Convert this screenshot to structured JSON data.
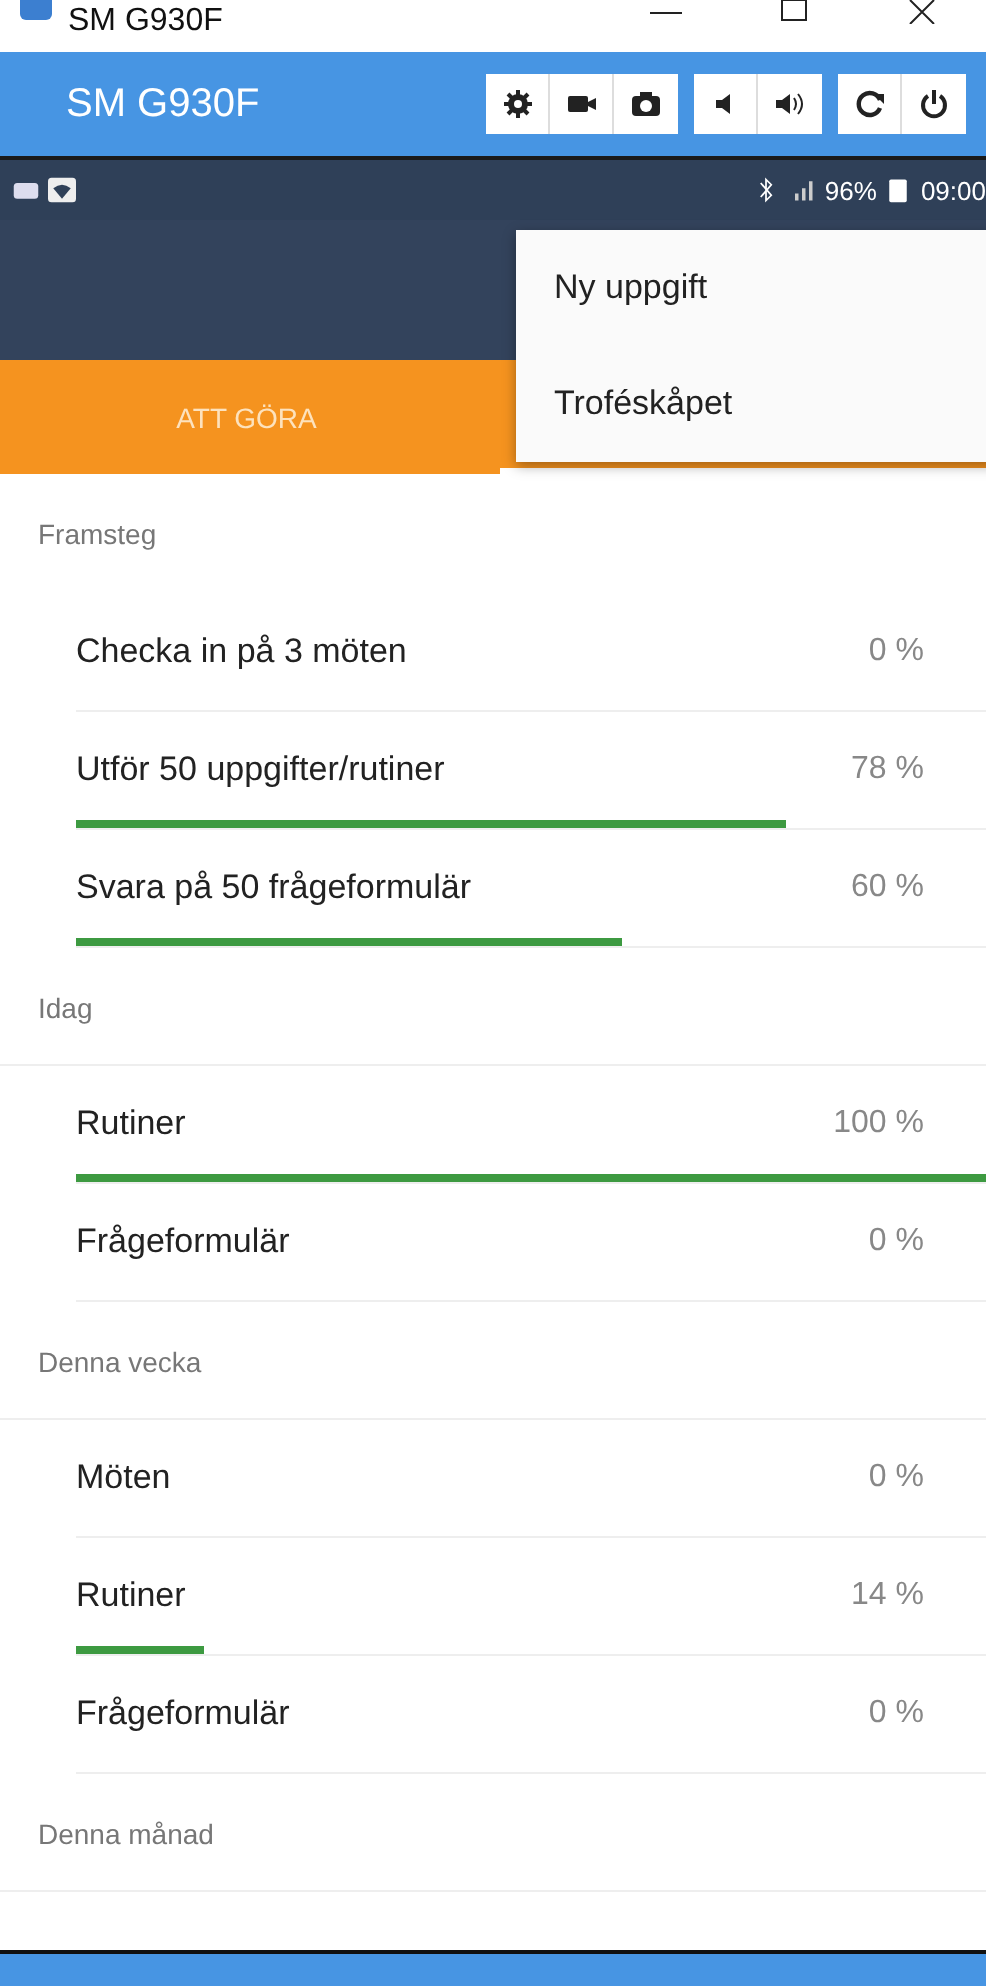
{
  "window": {
    "title": "SM G930F"
  },
  "toolbar": {
    "title": "SM G930F"
  },
  "status_bar": {
    "battery": "96%",
    "time": "09:00"
  },
  "tabs": [
    {
      "label": "ATT GÖRA",
      "selected": false
    }
  ],
  "menu": [
    {
      "label": "Ny uppgift"
    },
    {
      "label": "Troféskåpet"
    }
  ],
  "sections": [
    {
      "title": "Framsteg",
      "rows": [
        {
          "label": "Checka in på 3 möten",
          "reading": "0 %",
          "level": 0
        },
        {
          "label": "Utför 50 uppgifter/rutiner",
          "reading": "78 %",
          "level": 0.78
        },
        {
          "label": "Svara på 50 frågeformulär",
          "reading": "60 %",
          "level": 0.6
        }
      ]
    },
    {
      "title": "Idag",
      "rows": [
        {
          "label": "Rutiner",
          "reading": "100 %",
          "level": 1
        },
        {
          "label": "Frågeformulär",
          "reading": "0 %",
          "level": 0
        }
      ]
    },
    {
      "title": "Denna vecka",
      "rows": [
        {
          "label": "Möten",
          "reading": "0 %",
          "level": 0
        },
        {
          "label": "Rutiner",
          "reading": "14 %",
          "level": 0.14
        },
        {
          "label": "Frågeformulär",
          "reading": "0 %",
          "level": 0
        }
      ]
    },
    {
      "title": "Denna månad"
    }
  ]
}
